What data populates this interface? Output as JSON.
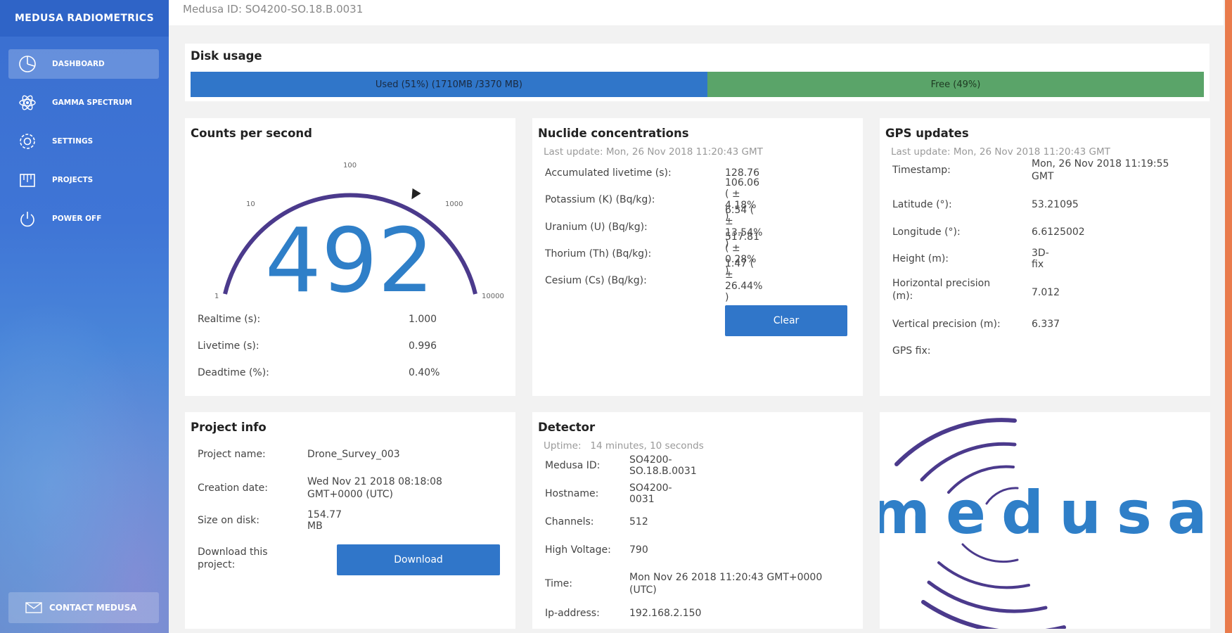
{
  "sidebar": {
    "brand": "MEDUSA RADIOMETRICS",
    "items": [
      {
        "label": "DASHBOARD",
        "icon": "dashboard-icon"
      },
      {
        "label": "GAMMA SPECTRUM",
        "icon": "atom-icon"
      },
      {
        "label": "SETTINGS",
        "icon": "gear-icon"
      },
      {
        "label": "PROJECTS",
        "icon": "folder-icon"
      },
      {
        "label": "POWER OFF",
        "icon": "power-icon"
      }
    ],
    "contact": "CONTACT MEDUSA"
  },
  "header": {
    "title": "Medusa ID: SO4200-SO.18.B.0031"
  },
  "disk": {
    "title": "Disk usage",
    "used_label": "Used (51%) (1710MB /3370 MB)",
    "free_label": "Free (49%)",
    "used_fraction": 0.51,
    "colors": {
      "used": "#3076c9",
      "free": "#5aa469"
    }
  },
  "cps": {
    "title": "Counts per second",
    "value": "492",
    "gauge": {
      "ticks": [
        "1",
        "10",
        "100",
        "1000",
        "10000"
      ],
      "needle_value": 492,
      "scale": "log",
      "min": 1,
      "max": 10000
    },
    "rows": [
      {
        "k": "Realtime (s):",
        "v": "1.000"
      },
      {
        "k": "Livetime (s):",
        "v": "0.996"
      },
      {
        "k": "Deadtime (%):",
        "v": "0.40%"
      }
    ]
  },
  "nuclides": {
    "title": "Nuclide concentrations",
    "last_update": "Last update: Mon, 26 Nov 2018 11:20:43 GMT",
    "rows": [
      {
        "k": "Accumulated livetime (s):",
        "v": "128.76"
      },
      {
        "k": "Potassium (K) (Bq/kg):",
        "v": "106.06 ( ± 4.18% )"
      },
      {
        "k": "Uranium (U) (Bq/kg):",
        "v": "6.54 ( ± 13.54% )"
      },
      {
        "k": "Thorium (Th) (Bq/kg):",
        "v": "517.81 ( ± 0.28% )"
      },
      {
        "k": "Cesium (Cs) (Bq/kg):",
        "v": "1.47 ( ± 26.44% )"
      }
    ],
    "clear_label": "Clear"
  },
  "gps": {
    "title": "GPS updates",
    "last_update": "Last update: Mon, 26 Nov 2018 11:20:43 GMT",
    "rows": [
      {
        "k": "Timestamp:",
        "v": "Mon, 26 Nov 2018 11:19:55 GMT"
      },
      {
        "k": "Latitude (°):",
        "v": "53.21095"
      },
      {
        "k": "Longitude (°):",
        "v": "6.6125002"
      },
      {
        "k": "Height (m):",
        "v": "3D-fix"
      },
      {
        "k": "Horizontal precision (m):",
        "v": "7.012"
      },
      {
        "k": "Vertical precision (m):",
        "v": "6.337"
      },
      {
        "k": "GPS fix:",
        "v": ""
      }
    ]
  },
  "project": {
    "title": "Project info",
    "rows": [
      {
        "k": "Project name:",
        "v": "Drone_Survey_003"
      },
      {
        "k": "Creation date:",
        "v": "Wed Nov 21 2018 08:18:08 GMT+0000 (UTC)"
      },
      {
        "k": "Size on disk:",
        "v": "154.77 MB"
      }
    ],
    "download_text": "Download this project:",
    "download_label": "Download"
  },
  "detector": {
    "title": "Detector",
    "uptime_label": "Uptime:",
    "uptime_value": "14 minutes, 10 seconds",
    "rows": [
      {
        "k": "Medusa ID:",
        "v": "SO4200-SO.18.B.0031"
      },
      {
        "k": "Hostname:",
        "v": "SO4200-0031"
      },
      {
        "k": "Channels:",
        "v": "512"
      },
      {
        "k": "High Voltage:",
        "v": "790"
      },
      {
        "k": "Time:",
        "v": "Mon Nov 26 2018 11:20:43 GMT+0000 (UTC)"
      },
      {
        "k": "Ip-address:",
        "v": "192.168.2.150"
      }
    ]
  },
  "logo": {
    "text": "medusa",
    "colors": {
      "text": "#2f7fc8",
      "arcs": "#4b3a8c"
    }
  }
}
